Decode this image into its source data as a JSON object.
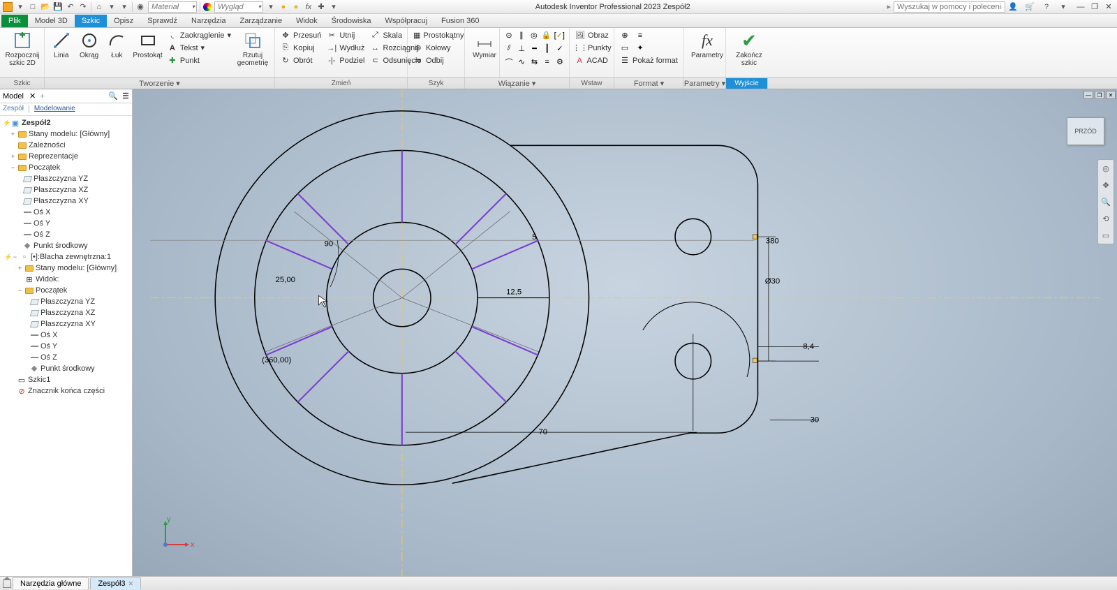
{
  "app": {
    "title": "Autodesk Inventor Professional 2023   Zespół2",
    "material_placeholder": "Materiał",
    "appearance_placeholder": "Wygląd",
    "search_placeholder": "Wyszukaj w pomocy i polecenia"
  },
  "tabs": {
    "file": "Plik",
    "items": [
      "Model 3D",
      "Szkic",
      "Opisz",
      "Sprawdź",
      "Narzędzia",
      "Zarządzanie",
      "Widok",
      "Środowiska",
      "Współpracuj",
      "Fusion 360"
    ],
    "active": "Szkic"
  },
  "ribbon": {
    "sketch": {
      "start": "Rozpocznij szkic 2D",
      "line": "Linia",
      "circle": "Okrąg",
      "arc": "Łuk",
      "rect": "Prostokąt",
      "fillet": "Zaokrąglenie",
      "text": "Tekst",
      "point": "Punkt",
      "project": "Rzutuj geometrię",
      "dim": "Wymiar",
      "params": "Parametry",
      "finish": "Zakończ szkic"
    },
    "modify": {
      "move": "Przesuń",
      "copy": "Kopiuj",
      "rotate": "Obrót",
      "trim": "Utnij",
      "extend": "Wydłuż",
      "split": "Podziel",
      "scale": "Skala",
      "stretch": "Rozciągnij",
      "offset": "Odsunięcie"
    },
    "pattern": {
      "rect": "Prostokątny",
      "circ": "Kołowy",
      "mirror": "Odbij"
    },
    "insert": {
      "image": "Obraz",
      "points": "Punkty",
      "acad": "ACAD"
    },
    "format": {
      "show": "Pokaż format"
    },
    "panels": [
      "Szkic",
      "Tworzenie",
      "Zmień",
      "Szyk",
      "Wiązanie",
      "Wstaw",
      "Format",
      "Parametry",
      "Wyjście"
    ]
  },
  "browser": {
    "title": "Model",
    "tabs": [
      "Zespół",
      "Modelowanie"
    ],
    "root": "Zespół2",
    "nodes": {
      "modelstates": "Stany modelu: [Główny]",
      "relations": "Zależności",
      "reps": "Reprezentacje",
      "origin": "Początek",
      "yz": "Płaszczyzna YZ",
      "xz": "Płaszczyzna XZ",
      "xy": "Płaszczyzna XY",
      "ax": "Oś X",
      "ay": "Oś Y",
      "az": "Oś Z",
      "cp": "Punkt środkowy",
      "part": "[•]:Blacha zewnętrzna:1",
      "view": "Widok:",
      "sk": "Szkic1",
      "eop": "Znacznik końca części"
    }
  },
  "viewcube": "PRZÓD",
  "bottom": {
    "home": "Narzędzia główne",
    "tab": "Zespół3"
  },
  "coord": {
    "x": "x",
    "y": "y"
  },
  "dims": {
    "d25": "25,00",
    "d90": "90",
    "d360": "(360,00)",
    "d125": "12,5",
    "d70": "70",
    "d30r": "30",
    "d30d": "Ø30",
    "d84": "8,4",
    "d380": "380",
    "dtop": "5"
  }
}
